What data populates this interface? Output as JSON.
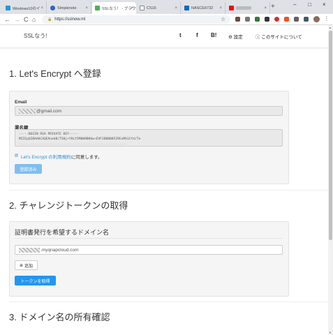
{
  "browser": {
    "tabs": [
      {
        "label": "Windows10のイ",
        "favicon_color": "#1e9bd8"
      },
      {
        "label": "Simplenote",
        "favicon_color": "#3361cc"
      },
      {
        "label": "SSLなう！ - ブラウザ",
        "favicon_color": "#4caf50"
      },
      {
        "label": "CS16",
        "favicon_color": "#888888"
      },
      {
        "label": "NASCE6732",
        "favicon_color": "#1565c0"
      },
      {
        "label": "",
        "favicon_color": "#ff0000"
      }
    ],
    "tab_close": "×",
    "new_tab": "+",
    "window_controls": {
      "minimize": "–",
      "maximize": "□",
      "close": "×"
    },
    "nav": {
      "back": "←",
      "forward": "→",
      "reload": "C",
      "home": "⌂"
    },
    "address": "https://sslnow.ml",
    "bookmark_star": "☆",
    "menu": "⋮"
  },
  "site": {
    "brand": "SSLなう!",
    "nav": {
      "twitter": "t",
      "facebook": "f",
      "hatena": "B!",
      "settings": "設定",
      "about": "このサイトについて"
    }
  },
  "section1": {
    "title": "1. Let's Encrypt へ登録",
    "email_label": "Email",
    "email_value": "@gmail.com",
    "key_label": "署名鍵",
    "key_lines": [
      "-----BEGIN RSA PRIVATE KEY-----",
      "MIIEpQIBAAKCAQEAnokB/TS0j+YHLY5M6W9BKHw+EVF1DKN08FZ9EvMA1Cfd/Te",
      "........................................................"
    ],
    "agree_link": "Let's Encrypt の利用規約",
    "agree_text": "に同意します。",
    "register_button": "登録済み"
  },
  "section2": {
    "title": "2. チャレンジトークンの取得",
    "legend": "証明書発行を希望するドメイン名",
    "domain_value": ".myqnapcloud.com",
    "add_button": "追加",
    "get_token_button": "トークンを取得"
  },
  "section3": {
    "title": "3. ドメイン名の所有確認"
  },
  "colors": {
    "primary": "#2196f3",
    "link": "#2a8fd9",
    "panel": "#f5f5f5"
  }
}
